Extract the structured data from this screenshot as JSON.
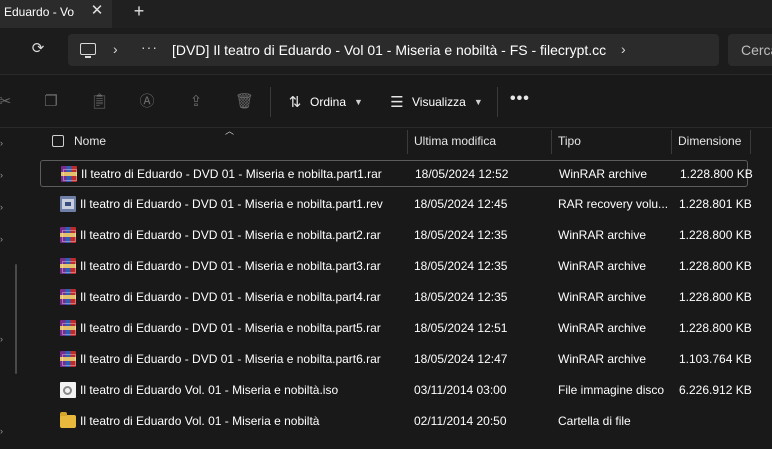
{
  "window": {
    "tab_title": "i Eduardo - Vo",
    "close_glyph": "✕",
    "new_tab_glyph": "+"
  },
  "address": {
    "refresh_glyph": "⟳",
    "chevron": "›",
    "more_glyph": "···",
    "path": "[DVD] Il teatro di Eduardo - Vol 01 - Miseria e nobiltà - FS - filecrypt.cc",
    "search_placeholder": "Cerca"
  },
  "toolbar": {
    "sort_label": "Ordina",
    "view_label": "Visualizza",
    "more_glyph": "•••",
    "icons": [
      "cut-icon",
      "copy-icon",
      "paste-icon",
      "rename-icon",
      "share-icon",
      "delete-icon"
    ]
  },
  "columns": {
    "name": "Nome",
    "modified": "Ultima modifica",
    "type": "Tipo",
    "size": "Dimensione"
  },
  "files": [
    {
      "name": "Il teatro di Eduardo - DVD 01 - Miseria e nobilta.part1.rar",
      "modified": "18/05/2024 12:52",
      "type": "WinRAR archive",
      "size": "1.228.800 KB",
      "icon": "rar-icon",
      "selected": true
    },
    {
      "name": "Il teatro di Eduardo - DVD 01 - Miseria e nobilta.part1.rev",
      "modified": "18/05/2024 12:45",
      "type": "RAR recovery volu...",
      "size": "1.228.801 KB",
      "icon": "rev-icon"
    },
    {
      "name": "Il teatro di Eduardo - DVD 01 - Miseria e nobilta.part2.rar",
      "modified": "18/05/2024 12:35",
      "type": "WinRAR archive",
      "size": "1.228.800 KB",
      "icon": "rar-icon"
    },
    {
      "name": "Il teatro di Eduardo - DVD 01 - Miseria e nobilta.part3.rar",
      "modified": "18/05/2024 12:35",
      "type": "WinRAR archive",
      "size": "1.228.800 KB",
      "icon": "rar-icon"
    },
    {
      "name": "Il teatro di Eduardo - DVD 01 - Miseria e nobilta.part4.rar",
      "modified": "18/05/2024 12:35",
      "type": "WinRAR archive",
      "size": "1.228.800 KB",
      "icon": "rar-icon"
    },
    {
      "name": "Il teatro di Eduardo - DVD 01 - Miseria e nobilta.part5.rar",
      "modified": "18/05/2024 12:51",
      "type": "WinRAR archive",
      "size": "1.228.800 KB",
      "icon": "rar-icon"
    },
    {
      "name": "Il teatro di Eduardo - DVD 01 - Miseria e nobilta.part6.rar",
      "modified": "18/05/2024 12:47",
      "type": "WinRAR archive",
      "size": "1.103.764 KB",
      "icon": "rar-icon"
    },
    {
      "name": "Il teatro di Eduardo Vol. 01 - Miseria e nobiltà.iso",
      "modified": "03/11/2014 03:00",
      "type": "File immagine disco",
      "size": "6.226.912 KB",
      "icon": "iso-icon"
    },
    {
      "name": "Il teatro di Eduardo Vol. 01 - Miseria e nobiltà",
      "modified": "02/11/2014 20:50",
      "type": "Cartella di file",
      "size": "",
      "icon": "folder-icon"
    }
  ],
  "colors": {
    "background": "#191919",
    "titlebar": "#202020",
    "addressbar": "#2b2b2b",
    "text": "#ffffff",
    "disabled_icon": "#6b6b6b"
  }
}
